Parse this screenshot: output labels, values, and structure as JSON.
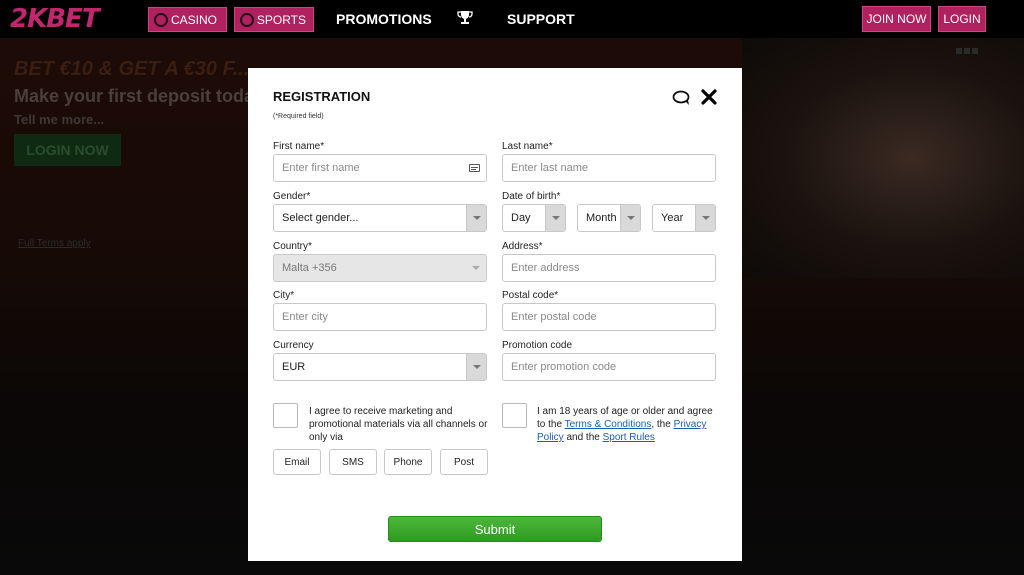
{
  "brand": {
    "logo": "2KBET",
    "accent": "#b0215f"
  },
  "nav": {
    "casino": "CASINO",
    "sports": "SPORTS",
    "promotions": "PROMOTIONS",
    "support": "SUPPORT",
    "join_now": "JOIN NOW",
    "login": "LOGIN"
  },
  "hero": {
    "title": "BET €10 & GET A €30 F...",
    "subtitle": "Make your first deposit today",
    "tell_more": "Tell me more...",
    "login_button": "LOGIN NOW",
    "terms": "Full Terms apply"
  },
  "modal": {
    "title": "REGISTRATION",
    "required_note": "(*Required field)",
    "first_name": {
      "label": "First name*",
      "placeholder": "Enter first name"
    },
    "last_name": {
      "label": "Last name*",
      "placeholder": "Enter last name"
    },
    "gender": {
      "label": "Gender*",
      "value": "Select gender..."
    },
    "dob": {
      "label": "Date of birth*",
      "day": "Day",
      "month": "Month",
      "year": "Year"
    },
    "country": {
      "label": "Country*",
      "value": "Malta +356"
    },
    "address": {
      "label": "Address*",
      "placeholder": "Enter address"
    },
    "city": {
      "label": "City*",
      "placeholder": "Enter city"
    },
    "postal": {
      "label": "Postal code*",
      "placeholder": "Enter postal code"
    },
    "currency": {
      "label": "Currency",
      "value": "EUR"
    },
    "promo": {
      "label": "Promotion code",
      "placeholder": "Enter promotion code"
    },
    "marketing_text": "I agree to receive marketing and promotional materials via all channels or only via",
    "age_text_1": "I am 18 years of age or older and agree to the ",
    "terms_link": "Terms & Conditions",
    "age_text_2": ", the ",
    "privacy_link": "Privacy Policy",
    "age_text_3": " and the ",
    "sport_rules_link": "Sport Rules",
    "channels": [
      "Email",
      "SMS",
      "Phone",
      "Post"
    ],
    "submit": "Submit"
  }
}
